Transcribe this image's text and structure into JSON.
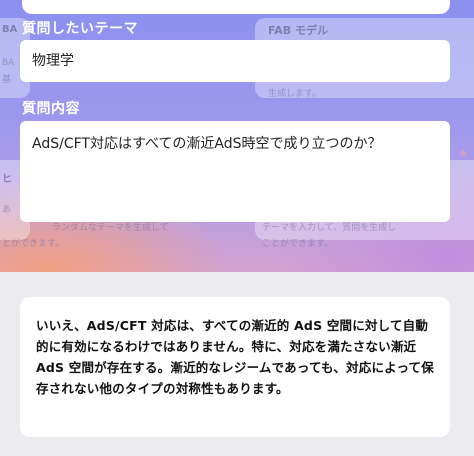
{
  "background": {
    "left_card_title_fragment": "BA",
    "left_card_text_fragment": "BA",
    "left_card_text_fragment_2": "基",
    "right_card_title": "FAB モデル",
    "right_card_text": "生成します。",
    "left_lower_title_fragment": "ヒ",
    "left_lower_text": "あ",
    "left_lower_text_2": "とができます。",
    "left_lower_text_mid": "ランダムなテーマを生成して",
    "right_lower_text": "テーマを入力して、質問を生成し",
    "right_lower_text_2": "ことができます。"
  },
  "form": {
    "theme_label": "質問したいテーマ",
    "theme_value": "物理学",
    "question_label": "質問内容",
    "question_value": "AdS/CFT対応はすべての漸近AdS時空で成り立つのか？"
  },
  "answer": {
    "text": "いいえ、AdS/CFT 対応は、すべての漸近的 AdS 空間に対して自動的に有効になるわけではありません。特に、対応を満たさない漸近 AdS 空間が存在する。漸近的なレジームであっても、対応によって保存されない他のタイプの対称性もあります。"
  }
}
